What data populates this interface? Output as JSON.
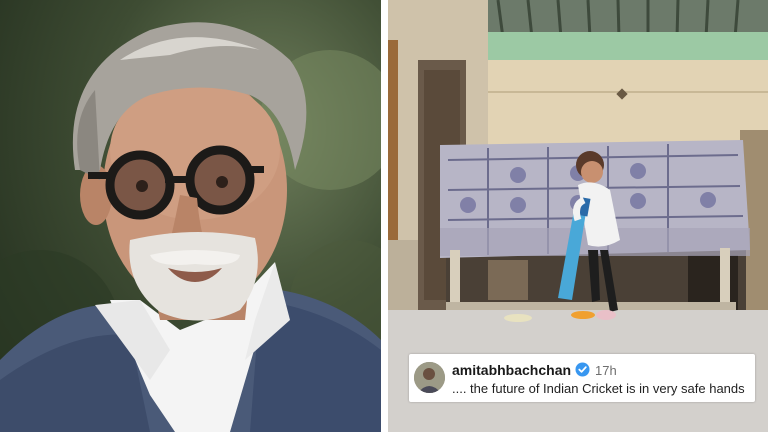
{
  "left_photo": {
    "icon": "portrait-photo"
  },
  "right_photo": {
    "icon": "child-batting-photo"
  },
  "comment": {
    "username": "amitabhbachchan",
    "time": "17h",
    "text": ".... the future of Indian Cricket is in very safe hands",
    "verified_icon": "verified-badge-icon",
    "verified_color": "#3897f0"
  }
}
